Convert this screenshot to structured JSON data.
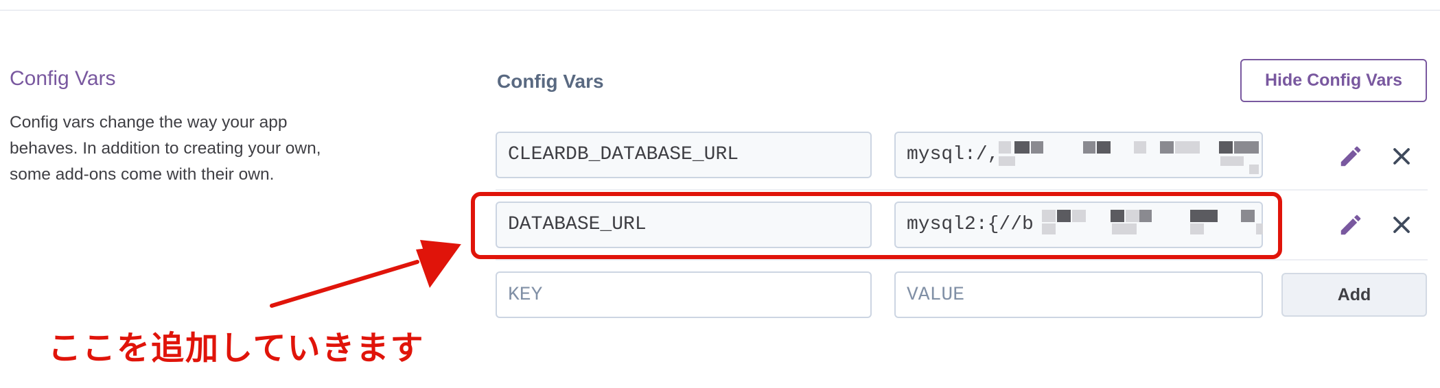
{
  "section": {
    "title": "Config Vars",
    "description": "Config vars change the way your app behaves. In addition to creating your own, some add-ons come with their own."
  },
  "panel": {
    "title": "Config Vars",
    "hide_button_label": "Hide Config Vars"
  },
  "config_vars": [
    {
      "key": "CLEARDB_DATABASE_URL",
      "value_visible": "mysql:/,"
    },
    {
      "key": "DATABASE_URL",
      "value_visible": "mysql2:{//b"
    }
  ],
  "new_var": {
    "key_placeholder": "KEY",
    "value_placeholder": "VALUE",
    "add_label": "Add"
  },
  "icons": {
    "edit": "pencil-icon",
    "delete": "close-icon"
  },
  "annotation": {
    "text": "ここを追加していきます",
    "color": "#e0140a"
  },
  "colors": {
    "brand_purple": "#79589f",
    "heading_slate": "#596981",
    "annotation_red": "#e0140a"
  }
}
